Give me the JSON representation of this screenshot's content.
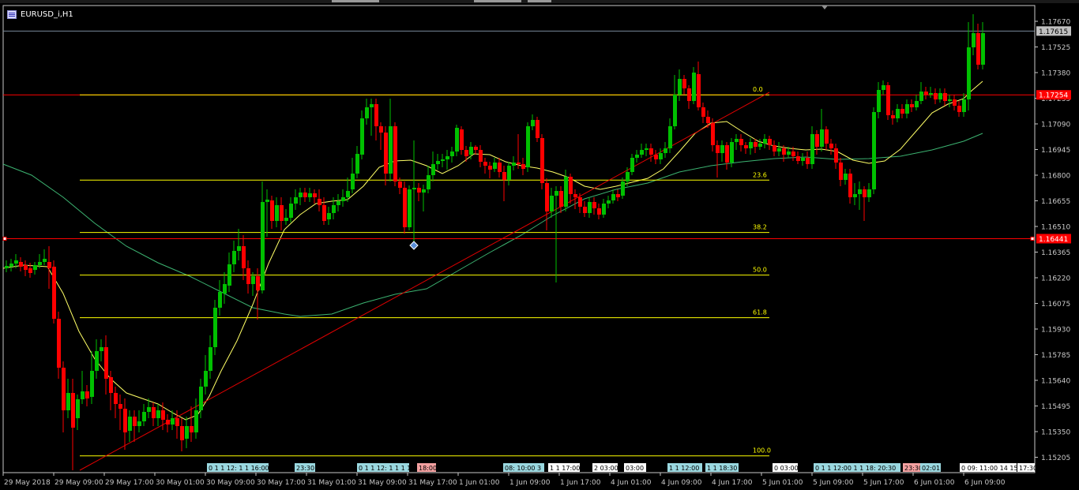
{
  "window": {
    "title": "EURUSD_i,H1"
  },
  "colors": {
    "background": "#000000",
    "axis": "#c8c8c8",
    "bull": "#00c000",
    "bear": "#ff0000",
    "fib": "#ffff00",
    "ma_fast": "#ffff66",
    "ma_slow": "#3cb371",
    "trendline": "#e00000",
    "bid_line": "#778899",
    "alert_line": "#ff0000"
  },
  "price_axis": {
    "labels": [
      "1.17670",
      "1.17525",
      "1.17380",
      "1.17235",
      "1.17090",
      "1.16945",
      "1.16800",
      "1.16655",
      "1.16510",
      "1.16365",
      "1.16220",
      "1.16075",
      "1.15930",
      "1.15785",
      "1.15640",
      "1.15495",
      "1.15350",
      "1.15205"
    ],
    "current_bid": "1.17615",
    "level_red_top": "1.17254",
    "level_red_mid": "1.16441"
  },
  "time_axis": {
    "labels": [
      "29 May 2018",
      "29 May 09:00",
      "29 May 17:00",
      "30 May 01:00",
      "30 May 09:00",
      "30 May 17:00",
      "31 May 01:00",
      "31 May 09:00",
      "31 May 17:00",
      "1 Jun 01:00",
      "1 Jun 09:00",
      "1 Jun 17:00",
      "4 Jun 01:00",
      "4 Jun 09:00",
      "4 Jun 17:00",
      "5 Jun 01:00",
      "5 Jun 09:00",
      "5 Jun 17:00",
      "6 Jun 01:00",
      "6 Jun 09:00"
    ]
  },
  "fibonacci": {
    "levels": [
      {
        "label": "0.0",
        "price": 1.17254
      },
      {
        "label": "23.6",
        "price": 1.16772
      },
      {
        "label": "38.2",
        "price": 1.16476
      },
      {
        "label": "50.0",
        "price": 1.16235
      },
      {
        "label": "61.8",
        "price": 1.15994
      },
      {
        "label": "100.0",
        "price": 1.15213
      }
    ]
  },
  "event_markers": [
    {
      "text": "0 1 1 12: 1 1 16:00",
      "color": "#9ad8e0"
    },
    {
      "text": "23:30",
      "color": "#9ad8e0"
    },
    {
      "text": "0 1 1 12: 1 1 1 1",
      "color": "#9ad8e0"
    },
    {
      "text": "18:00",
      "color": "#f4a0a0"
    },
    {
      "text": "08: 10:00 3",
      "color": "#9ad8e0"
    },
    {
      "text": "1 1 17:00",
      "color": "#ffffff"
    },
    {
      "text": "2 03:00",
      "color": "#ffffff"
    },
    {
      "text": "03:00",
      "color": "#ffffff"
    },
    {
      "text": "1 1 12:00",
      "color": "#9ad8e0"
    },
    {
      "text": "1 1 18:30",
      "color": "#9ad8e0"
    },
    {
      "text": "0 03:00",
      "color": "#ffffff"
    },
    {
      "text": "0 1 1 12:00 1 1 18: 20:30",
      "color": "#9ad8e0"
    },
    {
      "text": "23:30",
      "color": "#f4a0a0"
    },
    {
      "text": "02:01",
      "color": "#9ad8e0"
    },
    {
      "text": "0 09: 11:00 14 15:",
      "color": "#ffffff"
    },
    {
      "text": "17:30",
      "color": "#ffffff"
    }
  ]
}
